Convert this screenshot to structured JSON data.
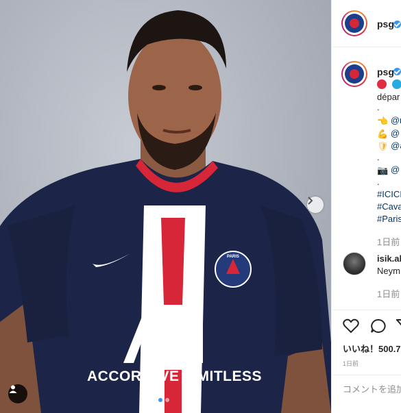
{
  "post": {
    "account": "psg",
    "caption": {
      "line1_emojis": [
        "red-circle",
        "blue-circle"
      ],
      "line2": "dépar",
      "line3": ".",
      "row1_tag": "@r",
      "row2_tag": "@",
      "row3_tag": "@a",
      "line7": ".",
      "row4_tag": "@",
      "line9": ".",
      "hashtag1": "#ICICI",
      "hashtag2": "#Cava",
      "hashtag3": "#Paris"
    },
    "caption_time": "1日前",
    "comment": {
      "user": "isik.ak",
      "text": "Neym",
      "time": "1日前"
    },
    "likes_label": "いいね！500.7",
    "date": "1日前",
    "comment_placeholder": "コメントを追加"
  },
  "photo": {
    "chest_text": "ACCOR LIVE LIMITLESS",
    "badge_text": "PARIS",
    "badge_sub": "SAINT-GERMAIN",
    "carousel_count": 2,
    "carousel_active": 1
  },
  "colors": {
    "jersey_navy": "#1c2547",
    "stripe_red": "#d72638",
    "link_blue": "#00376b",
    "verified_blue": "#3897f0"
  }
}
